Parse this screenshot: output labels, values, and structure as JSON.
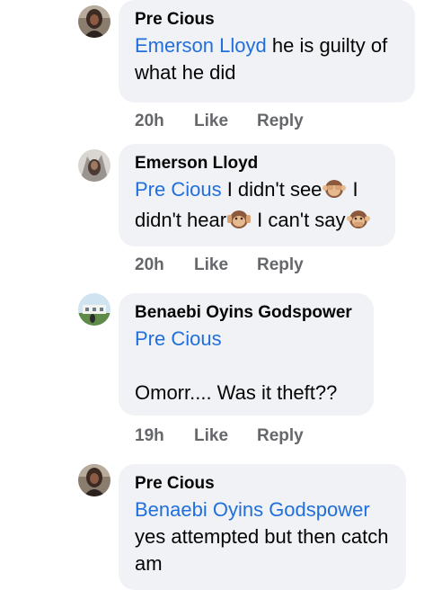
{
  "comments": [
    {
      "author": "Pre Cious",
      "mention": "Emerson Lloyd",
      "text_after_mention": " he is guilty of what he did",
      "time": "20h",
      "like_label": "Like",
      "reply_label": "Reply"
    },
    {
      "author": "Emerson Lloyd",
      "mention": "Pre Cious",
      "text_part1": " I didn't see",
      "text_part2": " I didn't hear",
      "text_part3": " I can't say",
      "emojis": [
        "see-no-evil-monkey-icon",
        "hear-no-evil-monkey-icon",
        "speak-no-evil-monkey-icon"
      ],
      "time": "20h",
      "like_label": "Like",
      "reply_label": "Reply"
    },
    {
      "author": "Benaebi Oyins Godspower",
      "mention": "Pre Cious",
      "text": "Omorr.... Was it theft??",
      "time": "19h",
      "like_label": "Like",
      "reply_label": "Reply"
    },
    {
      "author": "Pre Cious",
      "mention": "Benaebi Oyins Godspower",
      "text": "yes attempted but then catch am"
    }
  ],
  "colors": {
    "bubble": "#f0f2f5",
    "mention": "#216fdb",
    "meta": "#65676b",
    "text": "#050505"
  }
}
